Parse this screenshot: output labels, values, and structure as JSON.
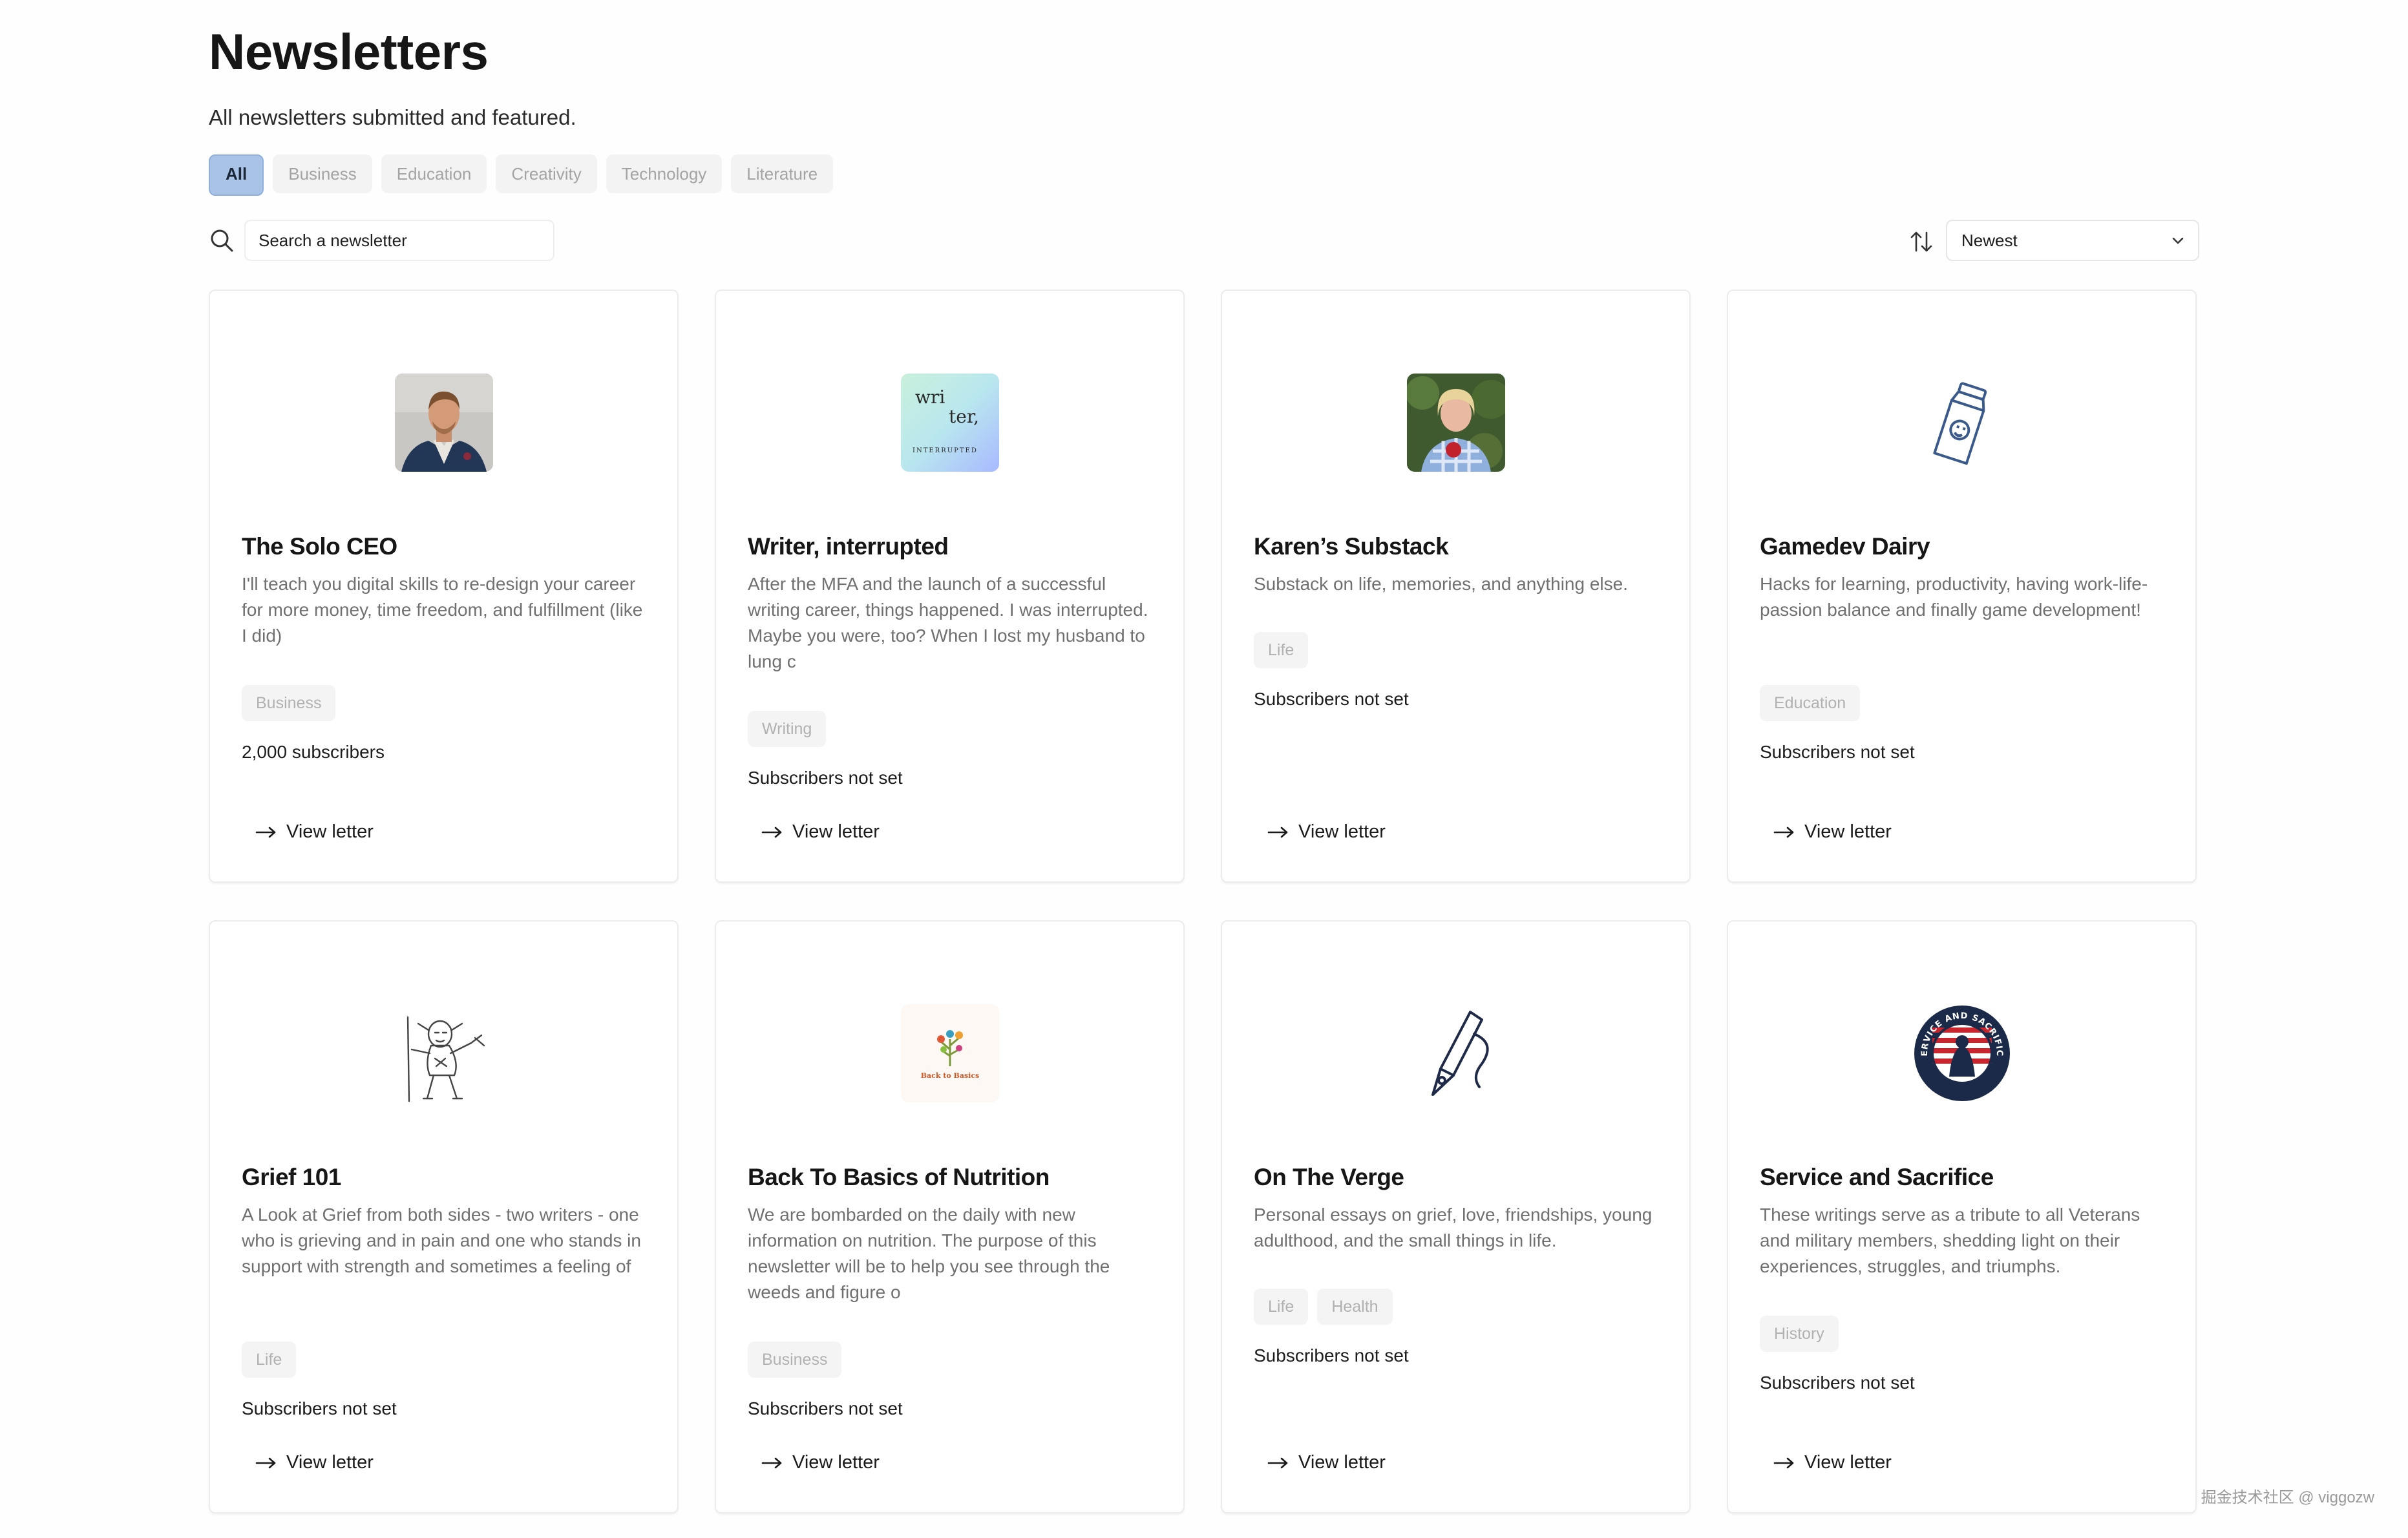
{
  "page": {
    "title": "Newsletters",
    "subtitle": "All newsletters submitted and featured."
  },
  "filters": [
    {
      "label": "All",
      "active": true
    },
    {
      "label": "Business",
      "active": false
    },
    {
      "label": "Education",
      "active": false
    },
    {
      "label": "Creativity",
      "active": false
    },
    {
      "label": "Technology",
      "active": false
    },
    {
      "label": "Literature",
      "active": false
    }
  ],
  "search": {
    "placeholder": "Search a newsletter",
    "icon": "search-icon"
  },
  "sort": {
    "icon": "sort-arrows-icon",
    "selected": "Newest"
  },
  "cards": [
    {
      "title": "The Solo CEO",
      "description": "I'll teach you digital skills to re-design your career for more money, time freedom, and fulfillment (like I did)",
      "tags": [
        "Business"
      ],
      "subscribers": "2,000 subscribers",
      "link_label": "View letter",
      "logo": "man-portrait-photo"
    },
    {
      "title": "Writer, interrupted",
      "description": "After the MFA and the launch of a successful writing career, things happened. I was interrupted. Maybe you were, too? When I lost my husband to lung c",
      "tags": [
        "Writing"
      ],
      "subscribers": "Subscribers not set",
      "link_label": "View letter",
      "logo": "gradient-wordmark",
      "logo_text": [
        "wri",
        "ter,",
        "INTERRUPTED"
      ]
    },
    {
      "title": "Karen’s Substack",
      "description": "Substack on life, memories, and anything else.",
      "tags": [
        "Life"
      ],
      "subscribers": "Subscribers not set",
      "link_label": "View letter",
      "logo": "woman-portrait-photo"
    },
    {
      "title": "Gamedev Dairy",
      "description": "Hacks for learning, productivity, having work-life-passion balance and finally game development!",
      "tags": [
        "Education"
      ],
      "subscribers": "Subscribers not set",
      "link_label": "View letter",
      "logo": "milk-carton-icon"
    },
    {
      "title": "Grief 101",
      "description": "A Look at Grief from both sides - two writers - one who is grieving and in pain and one who stands in support with strength and sometimes a feeling of",
      "tags": [
        "Life"
      ],
      "subscribers": "Subscribers not set",
      "link_label": "View letter",
      "logo": "goblin-sketch"
    },
    {
      "title": "Back To Basics of Nutrition",
      "description": "We are bombarded on the daily with new information on nutrition. The purpose of this newsletter will be to help you see through the weeds and figure o",
      "tags": [
        "Business"
      ],
      "subscribers": "Subscribers not set",
      "link_label": "View letter",
      "logo": "back-to-basics-logo",
      "logo_text": "Back to Basics"
    },
    {
      "title": "On The Verge",
      "description": "Personal essays on grief, love, friendships, young adulthood, and the small things in life.",
      "tags": [
        "Life",
        "Health"
      ],
      "subscribers": "Subscribers not set",
      "link_label": "View letter",
      "logo": "fountain-pen-icon"
    },
    {
      "title": "Service and Sacrifice",
      "description": "These writings serve as a tribute to all Veterans and military members, shedding light on their experiences, struggles, and triumphs.",
      "tags": [
        "History"
      ],
      "subscribers": "Subscribers not set",
      "link_label": "View letter",
      "logo": "service-sacrifice-seal",
      "logo_text": "SERVICE AND SACRIFICE"
    }
  ],
  "watermark": "掘金技术社区 @ viggozw",
  "colors": {
    "active_filter_bg": "#a9c3e6",
    "tag_bg": "#f4f4f4",
    "border": "#ececec"
  }
}
